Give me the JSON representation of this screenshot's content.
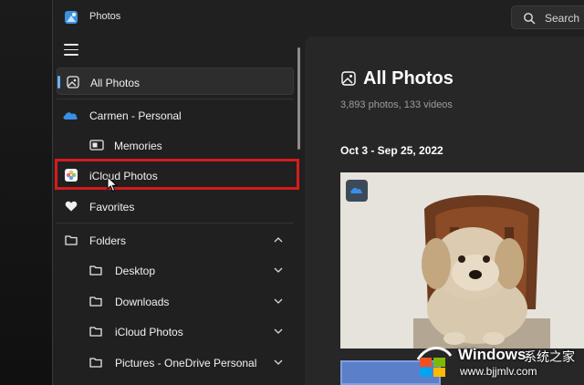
{
  "app": {
    "title": "Photos",
    "search_label": "Search"
  },
  "sidebar": {
    "items": [
      {
        "label": "All Photos",
        "icon": "photo-frame-icon",
        "selected": true
      },
      {
        "label": "Carmen - Personal",
        "icon": "onedrive-cloud-icon"
      },
      {
        "label": "Memories",
        "icon": "memories-icon"
      },
      {
        "label": "iCloud Photos",
        "icon": "icloud-photos-icon"
      },
      {
        "label": "Favorites",
        "icon": "heart-icon"
      },
      {
        "label": "Folders",
        "icon": "folder-icon",
        "expanded": true
      },
      {
        "label": "Desktop",
        "icon": "folder-icon"
      },
      {
        "label": "Downloads",
        "icon": "folder-icon"
      },
      {
        "label": "iCloud Photos",
        "icon": "folder-icon"
      },
      {
        "label": "Pictures - OneDrive Personal",
        "icon": "folder-icon"
      }
    ]
  },
  "main": {
    "title": "All Photos",
    "subtitle": "3,893 photos, 133 videos",
    "date_range": "Oct 3 - Sep 25, 2022"
  },
  "watermark": {
    "brand": "Windows",
    "suffix": "系统之家",
    "url": "www.bjjmlv.com"
  },
  "colors": {
    "accent": "#66b3ff",
    "highlight": "#d61b1b",
    "onedrive": "#3a8ee6"
  }
}
